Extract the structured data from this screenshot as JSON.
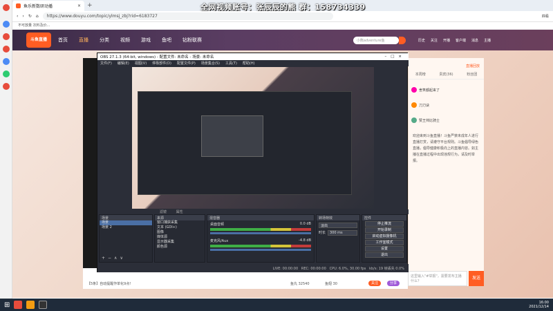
{
  "browser": {
    "tab_title": "鱼乐新数研动播",
    "url": "https://www.douyu.com/topic/ylmsj_zbj?rid=6183727",
    "bookmark": "不可放量 次料及价...",
    "ext_label": "四看"
  },
  "overlay": {
    "title": "全网视频账号：张辰辰的熊  群：158734339"
  },
  "douyu": {
    "logo": "斗鱼直播",
    "nav": [
      "首页",
      "直播",
      "分类",
      "视频",
      "游戏",
      "鱼吧",
      "钻粉联赛"
    ],
    "search_placeholder": "小熊adventure鱼",
    "top_icons": [
      "历史",
      "关注",
      "开播",
      "客户端",
      "消息",
      "主播"
    ],
    "right_panel": {
      "tabs": [
        "本周榜",
        "贵宾(36)",
        "粉丝团"
      ],
      "live_badge": "直播回放",
      "rank_rows": [
        "舍笑都起来了",
        "刀刀诀",
        "赞王帅比骑士"
      ],
      "notice": "欢迎来到斗鱼直播！斗鱼严禁未成年人进行直播打赏，请遵守平台规则。斗鱼倡导绿色直播，倡导健康积极向上的直播内容。如主播在直播过程中出现违规行为，请及时举报。",
      "chat_placeholder": "这里输入\"#举报\"，需要发布主播什么？",
      "send_label": "发送"
    },
    "bottom": {
      "gift_text": "【5条】自动提醒作单化9点!",
      "follow_label": "关注",
      "share_label": "分享",
      "count_a": "鱼丸 32540",
      "count_b": "鱼翅 30"
    }
  },
  "obs": {
    "title": "OBS 27.1.3 (64-bit, windows) - 配置文件: 未命名 - 场景: 未命名",
    "menu": [
      "文件(F)",
      "编辑(E)",
      "视图(V)",
      "停靠部件(D)",
      "配置文件(P)",
      "场景集合(S)",
      "工具(T)",
      "帮助(H)"
    ],
    "bar_label_a": "滤镜",
    "bar_label_b": "属性",
    "docks": {
      "scenes": {
        "title": "场景",
        "items": [
          "场景",
          "场景 2"
        ]
      },
      "sources": {
        "title": "来源",
        "items": [
          "窗口捕获采集",
          "文本 (GDI+)",
          "图像",
          "媒体源",
          "显示器采集",
          "颜色源"
        ]
      },
      "mixer": {
        "title": "混音器",
        "tracks": [
          {
            "name": "桌面音频",
            "db": "0.0 dB"
          },
          {
            "name": "麦克风/Aux",
            "db": "-4.8 dB"
          }
        ]
      },
      "transitions": {
        "title": "转场特效",
        "mode": "淡出",
        "duration_label": "时长",
        "duration": "300 ms"
      },
      "controls": {
        "title": "控件",
        "buttons": [
          "停止推流",
          "开始录制",
          "启动虚拟摄像机",
          "工作室模式",
          "设置",
          "退出"
        ]
      }
    },
    "status": {
      "live": "LIVE: 00:00:00",
      "rec": "REC: 00:00:00",
      "cpu": "CPU: 6.0%, 30.00 fps",
      "kbps": "kb/s: 19 帧丢失 0.0%"
    }
  },
  "taskbar": {
    "time": "16:00",
    "date": "2021/12/14"
  },
  "colors": {
    "douyu_brand": "#ff5d23",
    "obs_bg": "#2b2e38",
    "taskbar": "#1f2b3a"
  }
}
